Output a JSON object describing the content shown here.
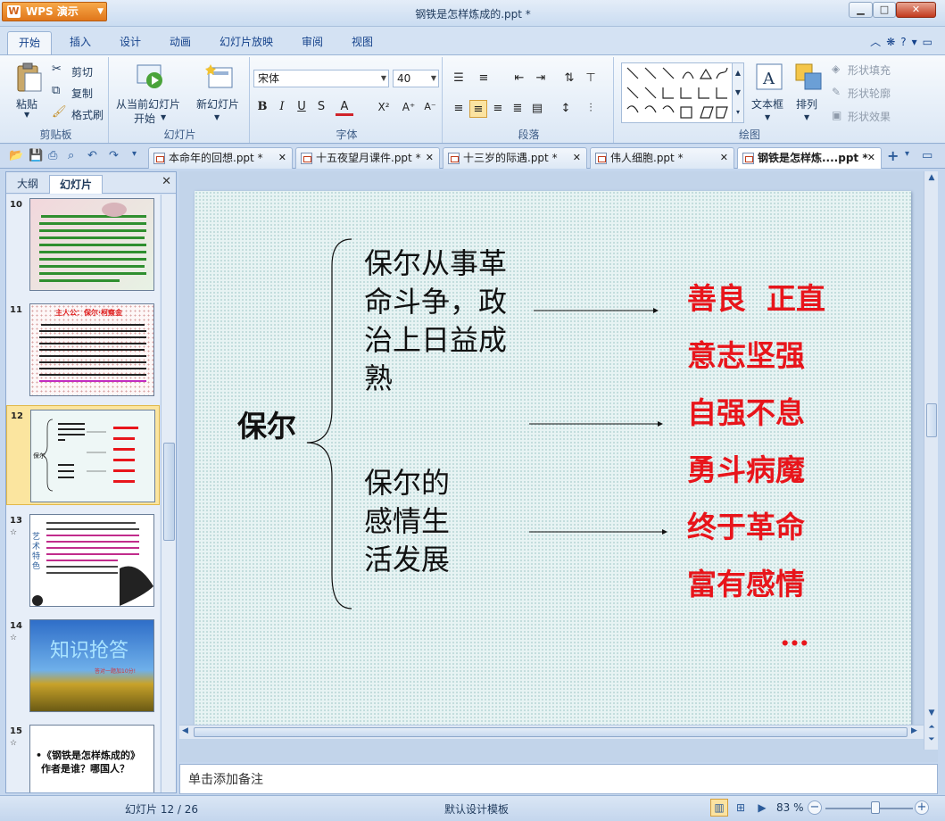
{
  "titlebar": {
    "app_name": "WPS 演示",
    "doc_title": "钢铁是怎样炼成的.ppt *",
    "min_icon": "minimize-icon",
    "max_icon": "maximize-icon",
    "close_icon": "close-icon"
  },
  "ribbon_tabs": [
    "开始",
    "插入",
    "设计",
    "动画",
    "幻灯片放映",
    "审阅",
    "视图"
  ],
  "ribbon_tabs_active": "开始",
  "ribbon": {
    "clipboard": {
      "label": "剪贴板",
      "paste": "粘贴",
      "cut": "剪切",
      "copy": "复制",
      "format_painter": "格式刷"
    },
    "slides": {
      "label": "幻灯片",
      "from_current_1": "从当前幻灯片",
      "from_current_2": "开始",
      "new_slide": "新幻灯片"
    },
    "font": {
      "label": "字体",
      "font_name": "宋体",
      "font_size": "40",
      "bold": "B",
      "italic": "I",
      "underline": "U",
      "strike": "S",
      "font_color": "A",
      "super": "X²",
      "grow": "A⁺",
      "shrink": "A⁻"
    },
    "paragraph": {
      "label": "段落"
    },
    "drawing": {
      "label": "绘图",
      "textbox": "文本框",
      "arrange": "排列",
      "shape_fill": "形状填充",
      "shape_outline": "形状轮廓",
      "shape_effect": "形状效果"
    }
  },
  "doc_tabs": [
    {
      "label": "本命年的回想.ppt *"
    },
    {
      "label": "十五夜望月课件.ppt *"
    },
    {
      "label": "十三岁的际遇.ppt *"
    },
    {
      "label": "伟人细胞.ppt *"
    },
    {
      "label": "钢铁是怎样炼....ppt *"
    }
  ],
  "left_pane": {
    "tab_outline": "大纲",
    "tab_slides": "幻灯片",
    "thumbs": [
      {
        "num": "10",
        "has_star": false
      },
      {
        "num": "11",
        "has_star": false,
        "title": "主人公：保尔·柯察金"
      },
      {
        "num": "12",
        "has_star": false,
        "selected": true
      },
      {
        "num": "13",
        "has_star": true,
        "side": "艺术特色"
      },
      {
        "num": "14",
        "has_star": true,
        "title": "知识抢答",
        "sub": "答对一题加10分!"
      },
      {
        "num": "15",
        "has_star": true,
        "text1": "•《钢铁是怎样炼成的》",
        "text2": "作者是谁？哪国人？"
      }
    ]
  },
  "slide": {
    "center": "保尔",
    "upper_left": [
      "保尔从事革",
      "命斗争，政",
      "治上日益成",
      "熟"
    ],
    "lower_left": [
      "保尔的",
      "感情生",
      "活发展"
    ],
    "traits": [
      "善良  正直",
      "意志坚强",
      "自强不息",
      "勇斗病魔",
      "终于革命",
      "富有感情",
      "…"
    ]
  },
  "notes_placeholder": "单击添加备注",
  "status": {
    "slide_pos": "幻灯片 12 / 26",
    "template": "默认设计模板",
    "zoom": "83 %",
    "zoom_value": 83
  },
  "colors": {
    "accent_red": "#e8151b",
    "app_orange": "#e0761a",
    "ribbon_blue": "#dbe7f5"
  }
}
